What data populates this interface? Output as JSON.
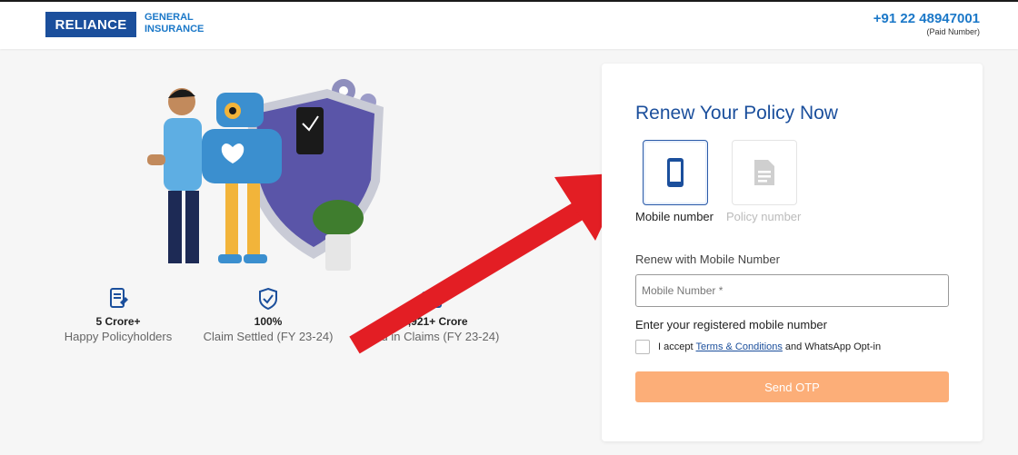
{
  "header": {
    "logo_text": "RELIANCE",
    "logo_sub_line1": "GENERAL",
    "logo_sub_line2": "INSURANCE",
    "phone": "+91 22 48947001",
    "phone_note": "(Paid Number)"
  },
  "stats": [
    {
      "value": "5 Crore+",
      "label": "Happy Policyholders",
      "icon": "document-icon"
    },
    {
      "value": "100%",
      "label": "Claim Settled (FY 23-24)",
      "icon": "shield-check-icon"
    },
    {
      "value": "16,921+ Crore",
      "label": "Paid in Claims (FY 23-24)",
      "icon": "rupee-wallet-icon"
    }
  ],
  "form": {
    "title": "Renew Your Policy Now",
    "option_mobile": "Mobile number",
    "option_policy": "Policy number",
    "section_label": "Renew with Mobile Number",
    "input_placeholder": "Mobile Number *",
    "helper": "Enter your registered mobile number",
    "consent_prefix": "I accept",
    "consent_link": "Terms & Conditions",
    "consent_suffix": "and WhatsApp Opt-in",
    "button": "Send OTP"
  },
  "colors": {
    "brand": "#1b4f9c",
    "accent": "#1b78c8",
    "button": "#fcae78",
    "arrow": "#e31e24"
  }
}
